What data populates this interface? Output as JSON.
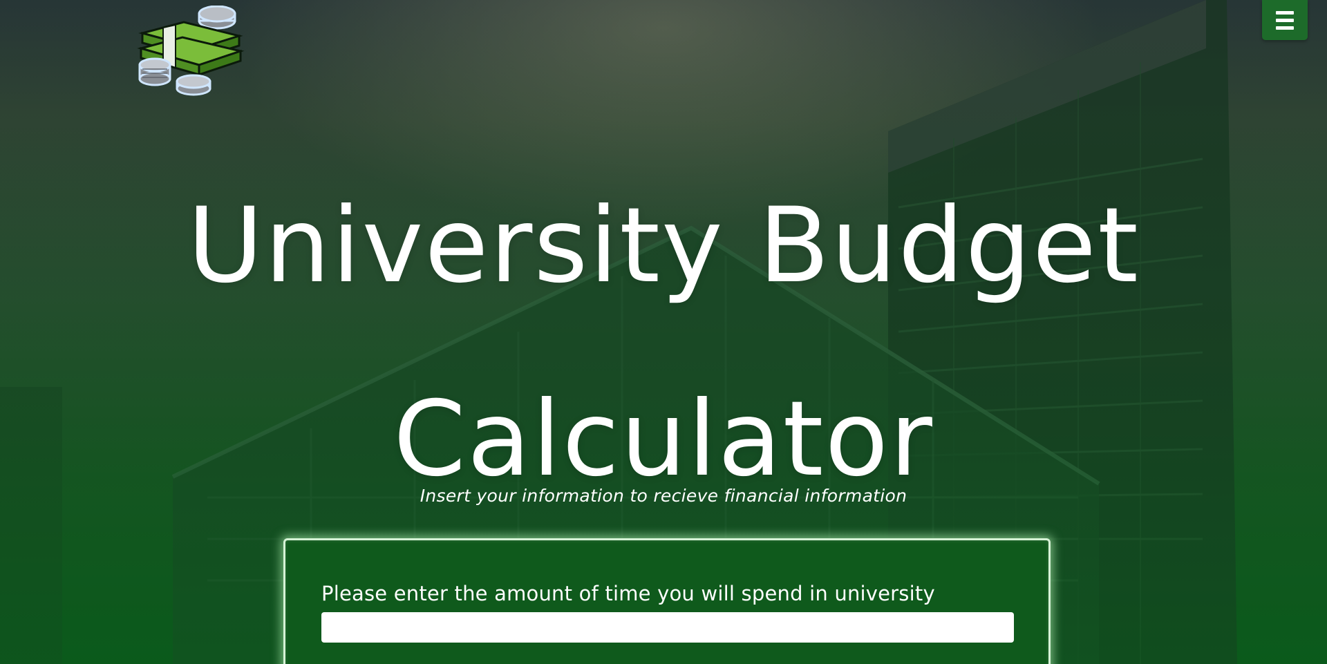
{
  "header": {
    "logo_icon": "money-stack-icon",
    "menu_icon": "hamburger-menu-icon"
  },
  "hero": {
    "title_line_1": "University Budget",
    "title_line_2": "Calculator",
    "subtitle": "Insert your information to recieve financial information"
  },
  "form": {
    "time_label": "Please enter the amount of time you will spend in university",
    "time_value": "",
    "time_placeholder": ""
  },
  "colors": {
    "brand_green": "#1d6b2a",
    "card_green": "#0f5a1c",
    "card_glow": "#d6f3d6",
    "text": "#ffffff"
  }
}
